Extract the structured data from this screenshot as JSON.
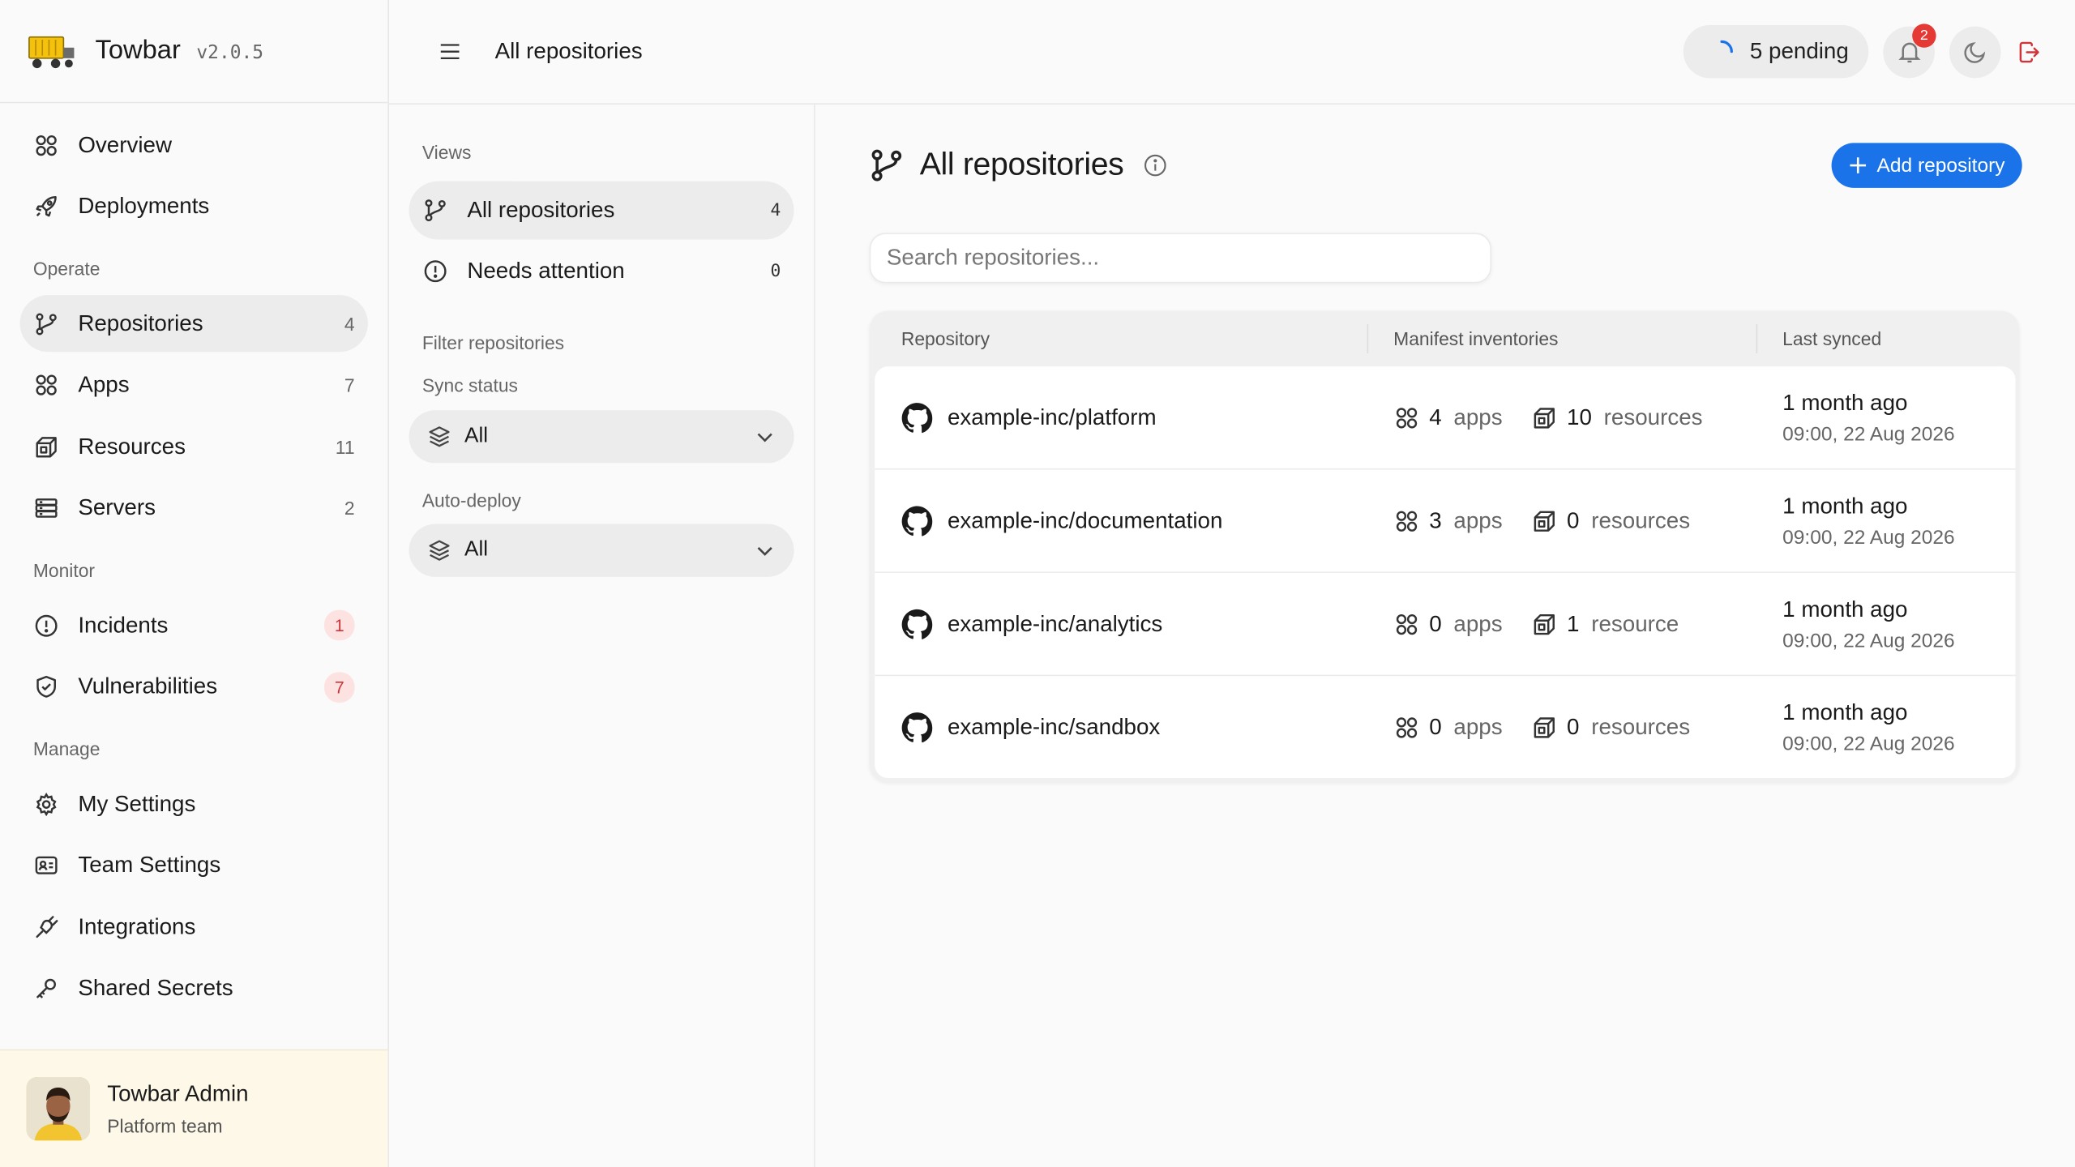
{
  "brand": {
    "name": "Towbar",
    "version": "v2.0.5"
  },
  "sidebar": {
    "top_items": [
      {
        "label": "Overview",
        "icon": "grid-icon"
      },
      {
        "label": "Deployments",
        "icon": "rocket-icon"
      }
    ],
    "sections": [
      {
        "title": "Operate",
        "items": [
          {
            "label": "Repositories",
            "count": "4",
            "icon": "branch-icon",
            "active": true
          },
          {
            "label": "Apps",
            "count": "7",
            "icon": "grid-icon"
          },
          {
            "label": "Resources",
            "count": "11",
            "icon": "box-icon"
          },
          {
            "label": "Servers",
            "count": "2",
            "icon": "server-icon"
          }
        ]
      },
      {
        "title": "Monitor",
        "items": [
          {
            "label": "Incidents",
            "count": "1",
            "icon": "alert-circle-icon"
          },
          {
            "label": "Vulnerabilities",
            "count": "7",
            "icon": "shield-icon"
          }
        ]
      },
      {
        "title": "Manage",
        "items": [
          {
            "label": "My Settings",
            "icon": "gear-icon"
          },
          {
            "label": "Team Settings",
            "icon": "id-card-icon"
          },
          {
            "label": "Integrations",
            "icon": "plug-icon"
          },
          {
            "label": "Shared Secrets",
            "icon": "key-icon"
          }
        ]
      }
    ],
    "user": {
      "name": "Towbar Admin",
      "team": "Platform team"
    }
  },
  "topbar": {
    "title": "All repositories",
    "pending_label": "5 pending",
    "notifications_count": "2"
  },
  "views": {
    "title": "Views",
    "items": [
      {
        "label": "All repositories",
        "count": "4"
      },
      {
        "label": "Needs attention",
        "count": "0"
      }
    ],
    "filter_title": "Filter repositories",
    "sync_status": {
      "label": "Sync status",
      "value": "All"
    },
    "auto_deploy": {
      "label": "Auto-deploy",
      "value": "All"
    }
  },
  "main": {
    "title": "All repositories",
    "add_button": "Add repository",
    "search_placeholder": "Search repositories...",
    "columns": [
      "Repository",
      "Manifest inventories",
      "Last synced"
    ],
    "rows": [
      {
        "repo": "example-inc/platform",
        "apps": "4",
        "apps_unit": "apps",
        "resources": "10",
        "resources_unit": "resources",
        "relative": "1 month ago",
        "absolute": "09:00, 22 Aug 2026"
      },
      {
        "repo": "example-inc/documentation",
        "apps": "3",
        "apps_unit": "apps",
        "resources": "0",
        "resources_unit": "resources",
        "relative": "1 month ago",
        "absolute": "09:00, 22 Aug 2026"
      },
      {
        "repo": "example-inc/analytics",
        "apps": "0",
        "apps_unit": "apps",
        "resources": "1",
        "resources_unit": "resource",
        "relative": "1 month ago",
        "absolute": "09:00, 22 Aug 2026"
      },
      {
        "repo": "example-inc/sandbox",
        "apps": "0",
        "apps_unit": "apps",
        "resources": "0",
        "resources_unit": "resources",
        "relative": "1 month ago",
        "absolute": "09:00, 22 Aug 2026"
      }
    ]
  },
  "colors": {
    "accent": "#1a73e8",
    "danger": "#e53935",
    "badge_bg": "#fde2e2",
    "user_bar_bg": "#fdf8e8"
  }
}
